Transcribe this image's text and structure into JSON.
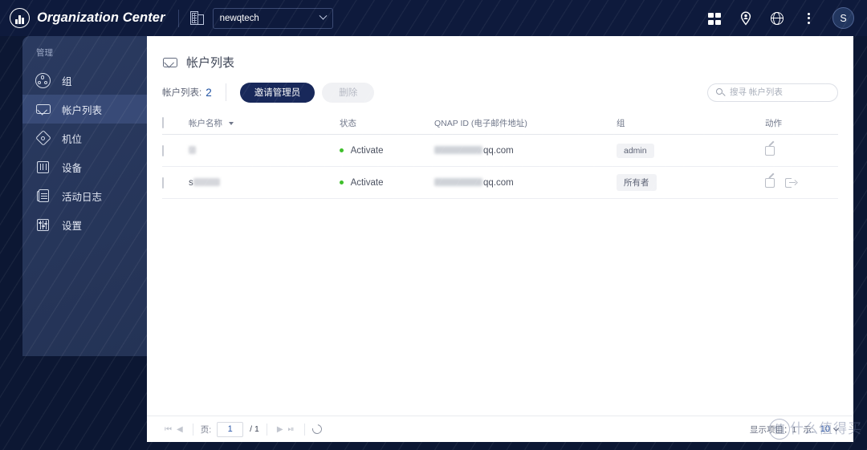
{
  "topbar": {
    "app_title": "Organization Center",
    "logo_icon": "org-logo-icon",
    "building_icon": "building-icon",
    "org_selected": "newqtech",
    "org_chevron_icon": "chevron-down-icon",
    "icons": {
      "apps_grid": "apps-grid-icon",
      "location_person": "location-person-icon",
      "globe": "globe-icon",
      "more": "more-vertical-icon"
    },
    "avatar_initial": "S"
  },
  "sidebar": {
    "section_title": "管理",
    "items": [
      {
        "label": "组",
        "icon": "group-icon",
        "active": false
      },
      {
        "label": "帐户列表",
        "icon": "mail-icon",
        "active": true
      },
      {
        "label": "机位",
        "icon": "seat-icon",
        "active": false
      },
      {
        "label": "设备",
        "icon": "device-icon",
        "active": false
      },
      {
        "label": "活动日志",
        "icon": "activity-log-icon",
        "active": false
      },
      {
        "label": "设置",
        "icon": "settings-sliders-icon",
        "active": false
      }
    ]
  },
  "page": {
    "title": "帐户列表",
    "title_icon": "mail-icon"
  },
  "toolbar": {
    "count_label": "帐户列表:",
    "count_value": "2",
    "invite_label": "邀请管理员",
    "delete_label": "删除",
    "search_placeholder": "搜寻 帐户列表",
    "search_value": "",
    "search_icon": "search-icon"
  },
  "table": {
    "columns": [
      {
        "key": "check",
        "label": ""
      },
      {
        "key": "name",
        "label": "帐户名称",
        "sorted": true
      },
      {
        "key": "state",
        "label": "状态"
      },
      {
        "key": "qnapid",
        "label": "QNAP ID (电子邮件地址)"
      },
      {
        "key": "group",
        "label": "组"
      },
      {
        "key": "action",
        "label": "动作"
      }
    ],
    "rows": [
      {
        "name": "",
        "name_redacted": true,
        "name_redacted_width": 9,
        "state": "Activate",
        "state_color": "#3fbf2c",
        "qnap_id_visible": "qq.com",
        "qnap_id_redacted_width": 60,
        "group": "admin",
        "actions": [
          "edit-icon"
        ]
      },
      {
        "name": "s",
        "name_redacted": true,
        "name_redacted_width": 33,
        "state": "Activate",
        "state_color": "#3fbf2c",
        "qnap_id_visible": "qq.com",
        "qnap_id_redacted_width": 60,
        "group": "所有者",
        "actions": [
          "edit-icon",
          "exit-icon"
        ]
      }
    ]
  },
  "footer": {
    "first_icon": "page-first-icon",
    "prev_icon": "page-prev-icon",
    "page_label": "页:",
    "page_value": "1",
    "page_total": "/ 1",
    "next_icon": "page-next-icon",
    "last_icon": "page-last-icon",
    "refresh_icon": "refresh-icon",
    "showing_label": "显示项目：1",
    "per_page_label": "示:",
    "per_page_value": "10",
    "per_page_chevron": "chevron-down-icon"
  },
  "watermark": {
    "mark": "值",
    "text": "什么值得买"
  },
  "colors": {
    "topbar_bg": "#0e1a3c",
    "page_bg": "#0c1733",
    "sidebar_bg": "#2a3a60",
    "primary_button": "#18285a",
    "accent_blue": "#1c4fa0",
    "status_green": "#3fbf2c"
  }
}
